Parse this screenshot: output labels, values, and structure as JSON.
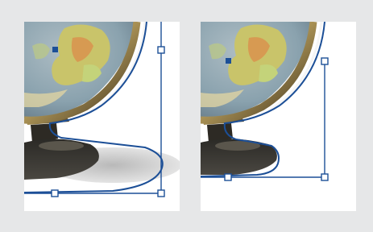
{
  "figure": {
    "panels": [
      {
        "label": "",
        "description": ""
      },
      {
        "label": "",
        "description": ""
      }
    ]
  },
  "colors": {
    "background": "#e6e7e8",
    "panel": "#ffffff",
    "path_stroke": "#1c4f97",
    "anchor_fill": "#1c4f97",
    "handle_fill": "#ffffff"
  },
  "icons": {
    "globe": "globe-image",
    "anchor": "anchor-point-icon",
    "handle": "bounding-handle-icon"
  }
}
